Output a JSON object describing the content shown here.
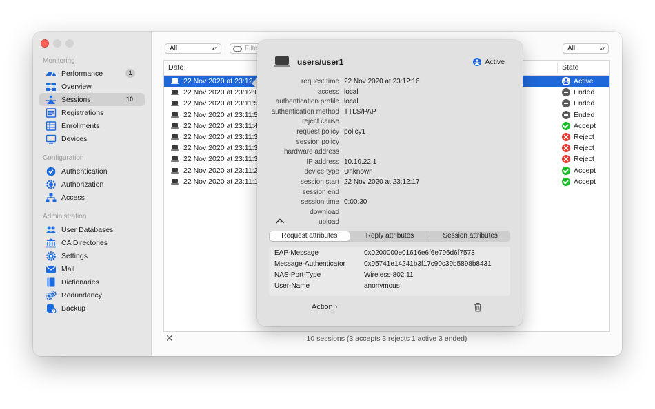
{
  "sidebar": {
    "sections": [
      {
        "title": "Monitoring",
        "items": [
          {
            "label": "Performance",
            "icon": "gauge-icon",
            "badge": "1"
          },
          {
            "label": "Overview",
            "icon": "network-icon",
            "badge": ""
          },
          {
            "label": "Sessions",
            "icon": "sessions-icon",
            "badge": "10",
            "selected": true
          },
          {
            "label": "Registrations",
            "icon": "registrations-icon",
            "badge": ""
          },
          {
            "label": "Enrollments",
            "icon": "enrollments-icon",
            "badge": ""
          },
          {
            "label": "Devices",
            "icon": "devices-icon",
            "badge": ""
          }
        ]
      },
      {
        "title": "Configuration",
        "items": [
          {
            "label": "Authentication",
            "icon": "checkmark-seal-icon",
            "badge": ""
          },
          {
            "label": "Authorization",
            "icon": "gear-badge-icon",
            "badge": ""
          },
          {
            "label": "Access",
            "icon": "hierarchy-icon",
            "badge": ""
          }
        ]
      },
      {
        "title": "Administration",
        "items": [
          {
            "label": "User Databases",
            "icon": "users-icon",
            "badge": ""
          },
          {
            "label": "CA Directories",
            "icon": "bank-icon",
            "badge": ""
          },
          {
            "label": "Settings",
            "icon": "gear-icon",
            "badge": ""
          },
          {
            "label": "Mail",
            "icon": "mail-icon",
            "badge": ""
          },
          {
            "label": "Dictionaries",
            "icon": "book-icon",
            "badge": ""
          },
          {
            "label": "Redundancy",
            "icon": "gears-icon",
            "badge": ""
          },
          {
            "label": "Backup",
            "icon": "database-icon",
            "badge": ""
          }
        ]
      }
    ]
  },
  "toolbar": {
    "filter_left_value": "All",
    "filter_placeholder": "Filte",
    "filter_right_value": "All"
  },
  "table": {
    "col_date": "Date",
    "col_state": "State",
    "rows": [
      {
        "date": "22 Nov 2020 at 23:12",
        "state": "Active",
        "state_kind": "active",
        "selected": true
      },
      {
        "date": "22 Nov 2020 at 23:12:0",
        "state": "Ended",
        "state_kind": "ended"
      },
      {
        "date": "22 Nov 2020 at 23:11:5",
        "state": "Ended",
        "state_kind": "ended"
      },
      {
        "date": "22 Nov 2020 at 23:11:5",
        "state": "Ended",
        "state_kind": "ended"
      },
      {
        "date": "22 Nov 2020 at 23:11:4",
        "state": "Accept",
        "state_kind": "accept"
      },
      {
        "date": "22 Nov 2020 at 23:11:3",
        "state": "Reject",
        "state_kind": "reject"
      },
      {
        "date": "22 Nov 2020 at 23:11:3",
        "state": "Reject",
        "state_kind": "reject"
      },
      {
        "date": "22 Nov 2020 at 23:11:3",
        "state": "Reject",
        "state_kind": "reject"
      },
      {
        "date": "22 Nov 2020 at 23:11:2",
        "state": "Accept",
        "state_kind": "accept"
      },
      {
        "date": "22 Nov 2020 at 23:11:1",
        "state": "Accept",
        "state_kind": "accept"
      }
    ]
  },
  "footer": {
    "summary": "10 sessions (3 accepts 3 rejects 1 active 3 ended)"
  },
  "popover": {
    "title": "users/user1",
    "status": "Active",
    "details": [
      {
        "key": "request time",
        "value": "22 Nov 2020 at 23:12:16"
      },
      {
        "key": "access",
        "value": "local"
      },
      {
        "key": "authentication profile",
        "value": "local"
      },
      {
        "key": "authentication method",
        "value": "TTLS/PAP"
      },
      {
        "key": "reject cause",
        "value": ""
      },
      {
        "key": "request policy",
        "value": "policy1"
      },
      {
        "key": "session policy",
        "value": ""
      },
      {
        "key": "hardware address",
        "value": ""
      },
      {
        "key": "IP address",
        "value": "10.10.22.1"
      },
      {
        "key": "device type",
        "value": "Unknown"
      },
      {
        "key": "session start",
        "value": "22 Nov 2020 at 23:12:17"
      },
      {
        "key": "session end",
        "value": ""
      },
      {
        "key": "session time",
        "value": "0:00:30"
      },
      {
        "key": "download",
        "value": ""
      },
      {
        "key": "upload",
        "value": ""
      }
    ],
    "tabs": [
      "Request attributes",
      "Reply attributes",
      "Session attributes"
    ],
    "selected_tab": 0,
    "attributes": [
      {
        "key": "EAP-Message",
        "value": "0x0200000e01616e6f6e796d6f7573"
      },
      {
        "key": "Message-Authenticator",
        "value": "0x95741e14241b3f17c90c39b5898b8431"
      },
      {
        "key": "NAS-Port-Type",
        "value": "Wireless-802.11"
      },
      {
        "key": "User-Name",
        "value": "anonymous"
      }
    ],
    "action_label": "Action",
    "action_chevron": "›"
  },
  "colors": {
    "accent": "#1f68d9",
    "sidebar_icon": "#1a6ae0",
    "accept": "#1cbf2a",
    "reject": "#e8352a",
    "ended": "#5b5b5b"
  }
}
